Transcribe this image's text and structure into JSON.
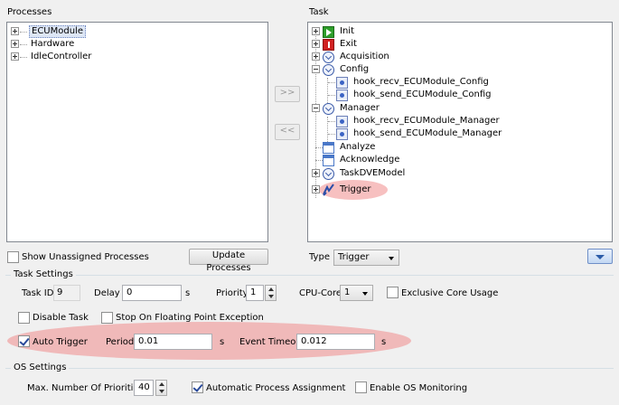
{
  "processes": {
    "title": "Processes",
    "items": [
      "ECUModule",
      "Hardware",
      "IdleController"
    ]
  },
  "task": {
    "title": "Task",
    "items": {
      "init": "Init",
      "exit": "Exit",
      "acquisition": "Acquisition",
      "config": "Config",
      "hook_recv_config": "hook_recv_ECUModule_Config",
      "hook_send_config": "hook_send_ECUModule_Config",
      "manager": "Manager",
      "hook_recv_manager": "hook_recv_ECUModule_Manager",
      "hook_send_manager": "hook_send_ECUModule_Manager",
      "analyze": "Analyze",
      "acknowledge": "Acknowledge",
      "taskdve": "TaskDVEModel",
      "trigger": "Trigger"
    }
  },
  "buttons": {
    "move_right": ">>",
    "move_left": "<<",
    "update_processes": "Update Processes"
  },
  "show_unassigned": {
    "label": "Show Unassigned Processes",
    "checked": false
  },
  "type": {
    "label": "Type",
    "value": "Trigger"
  },
  "task_settings": {
    "title": "Task Settings",
    "task_id_label": "Task ID",
    "task_id_value": "9",
    "delay_label": "Delay",
    "delay_value": "0",
    "delay_unit": "s",
    "priority_label": "Priority",
    "priority_value": "1",
    "cpu_core_label": "CPU-Core",
    "cpu_core_value": "1",
    "exclusive_core_label": "Exclusive Core Usage",
    "disable_task_label": "Disable Task",
    "stop_fp_label": "Stop On Floating Point Exception",
    "auto_trigger_label": "Auto Trigger",
    "auto_trigger_checked": true,
    "period_label": "Period",
    "period_value": "0.01",
    "period_unit": "s",
    "event_timeout_label": "Event Timeout",
    "event_timeout_value": "0.012",
    "event_timeout_unit": "s"
  },
  "os_settings": {
    "title": "OS Settings",
    "max_priorities_label": "Max. Number Of Priorities",
    "max_priorities_value": "40",
    "auto_assign_label": "Automatic Process Assignment",
    "auto_assign_checked": true,
    "os_monitoring_label": "Enable OS Monitoring",
    "os_monitoring_checked": false
  },
  "colors": {
    "highlight": "#f08c8c",
    "selection_accent": "#3a5aa8"
  }
}
